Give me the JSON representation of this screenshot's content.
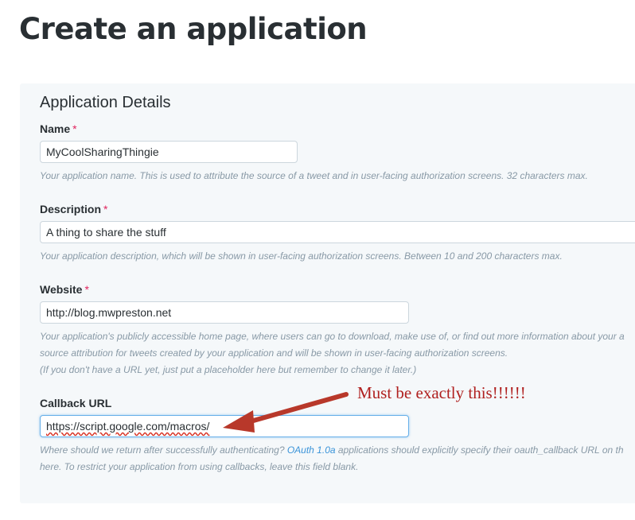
{
  "page": {
    "title": "Create an application"
  },
  "section": {
    "title": "Application Details"
  },
  "fields": {
    "name": {
      "label": "Name",
      "required": "*",
      "value": "MyCoolSharingThingie",
      "help": "Your application name. This is used to attribute the source of a tweet and in user-facing authorization screens. 32 characters max."
    },
    "description": {
      "label": "Description",
      "required": "*",
      "value": "A thing to share the stuff",
      "help": "Your application description, which will be shown in user-facing authorization screens. Between 10 and 200 characters max."
    },
    "website": {
      "label": "Website",
      "required": "*",
      "value": "http://blog.mwpreston.net",
      "help_line1": "Your application's publicly accessible home page, where users can go to download, make use of, or find out more information about your a",
      "help_line2": "source attribution for tweets created by your application and will be shown in user-facing authorization screens.",
      "help_line3": "(If you don't have a URL yet, just put a placeholder here but remember to change it later.)"
    },
    "callback": {
      "label": "Callback URL",
      "value": "https://script.google.com/macros/",
      "help_line1_before": "Where should we return after successfully authenticating? ",
      "help_link": "OAuth 1.0a",
      "help_line1_after": " applications should explicitly specify their oauth_callback URL on th",
      "help_line2": "here. To restrict your application from using callbacks, leave this field blank."
    }
  },
  "annotation": {
    "text": "Must be exactly this!!!!!!",
    "color": "#b8382a"
  }
}
